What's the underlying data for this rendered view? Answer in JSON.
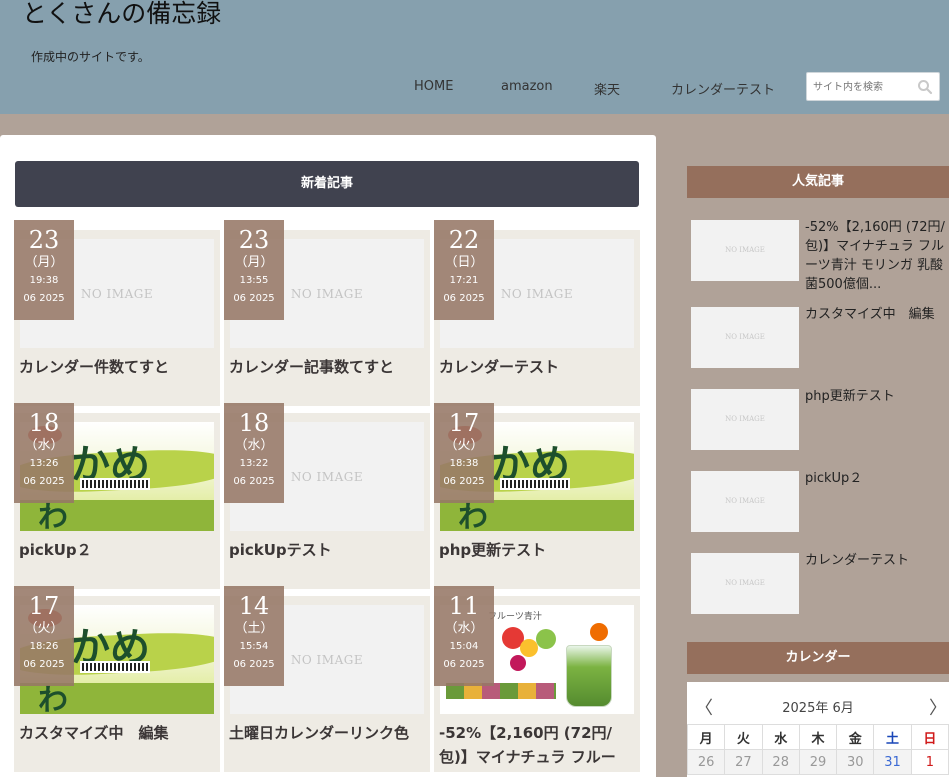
{
  "site": {
    "title": "とくさんの備忘録",
    "tagline": "作成中のサイトです。"
  },
  "nav": {
    "items": [
      "HOME",
      "amazon",
      "楽天",
      "カレンダーテスト"
    ]
  },
  "search": {
    "placeholder": "サイト内を検索"
  },
  "main": {
    "section_title": "新着記事",
    "no_image": "NO IMAGE",
    "cards": [
      {
        "day": "23",
        "weekday": "（月）",
        "time": "19:38",
        "month_year": "06 2025",
        "title": "カレンダー件数てすと",
        "image": "none"
      },
      {
        "day": "23",
        "weekday": "（月）",
        "time": "13:55",
        "month_year": "06 2025",
        "title": "カレンダー記事数てすと",
        "image": "none"
      },
      {
        "day": "22",
        "weekday": "（日）",
        "time": "17:21",
        "month_year": "06 2025",
        "title": "カレンダーテスト",
        "image": "none"
      },
      {
        "day": "18",
        "weekday": "（水）",
        "time": "13:26",
        "month_year": "06 2025",
        "title": "pickUp２",
        "image": "noodle-cup"
      },
      {
        "day": "18",
        "weekday": "（水）",
        "time": "13:22",
        "month_year": "06 2025",
        "title": "pickUpテスト",
        "image": "none"
      },
      {
        "day": "17",
        "weekday": "（火）",
        "time": "18:38",
        "month_year": "06 2025",
        "title": "php更新テスト",
        "image": "noodle-cup"
      },
      {
        "day": "17",
        "weekday": "（火）",
        "time": "18:26",
        "month_year": "06 2025",
        "title": "カスタマイズ中　編集",
        "image": "noodle-cup"
      },
      {
        "day": "14",
        "weekday": "（土）",
        "time": "15:54",
        "month_year": "06 2025",
        "title": "土曜日カレンダーリンク色",
        "image": "none"
      },
      {
        "day": "11",
        "weekday": "（水）",
        "time": "15:04",
        "month_year": "06 2025",
        "title": "-52%【2,160円 (72円/包)】マイナチュラ フルー",
        "image": "aojiru"
      }
    ]
  },
  "sidebar": {
    "popular_title": "人気記事",
    "popular_no_image": "NO IMAGE",
    "popular": [
      {
        "title": "-52%【2,160円 (72円/包)】マイナチュラ フルーツ青汁 モリンガ 乳酸菌500億個..."
      },
      {
        "title": "カスタマイズ中　編集"
      },
      {
        "title": "php更新テスト"
      },
      {
        "title": "pickUp２"
      },
      {
        "title": "カレンダーテスト"
      }
    ],
    "calendar_title": "カレンダー",
    "calendar": {
      "month_label": "2025年 6月",
      "prev": "〈",
      "next": "〉",
      "weekdays": [
        "月",
        "火",
        "水",
        "木",
        "金",
        "土",
        "日"
      ],
      "first_row": [
        "26",
        "27",
        "28",
        "29",
        "30",
        "31",
        "1"
      ]
    }
  },
  "colors": {
    "header_bg": "#86a0ae",
    "page_bg": "#b0a298",
    "section_bar": "#40424f",
    "date_badge": "#967766",
    "sidebar_head": "#956f5c"
  }
}
